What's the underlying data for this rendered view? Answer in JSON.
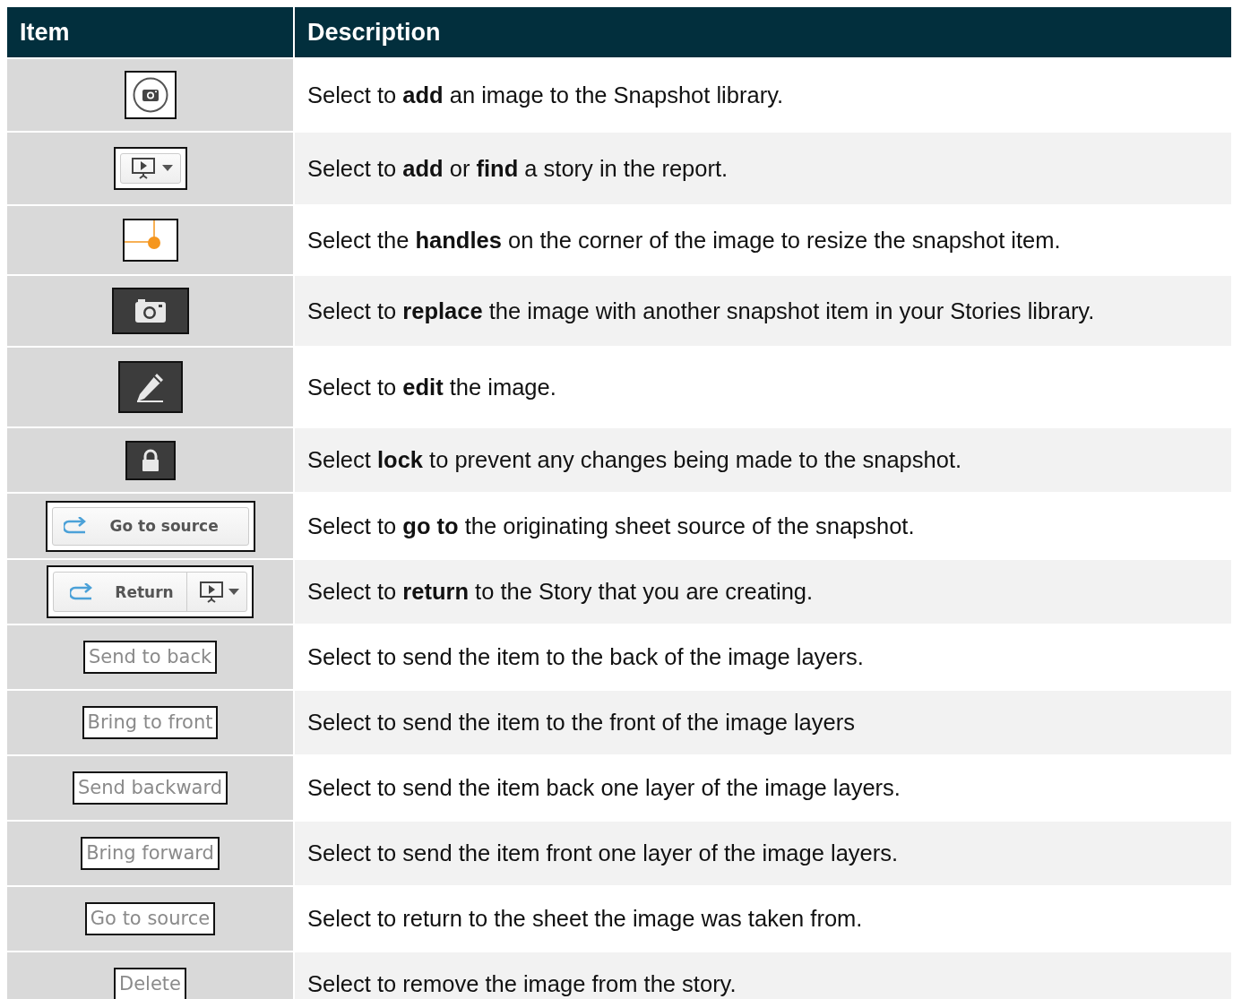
{
  "table": {
    "columns": [
      "Item",
      "Description"
    ],
    "rows": [
      {
        "item": {
          "kind": "camera-circle"
        },
        "description": "Select to **add** an image to the Snapshot library."
      },
      {
        "item": {
          "kind": "story-dropdown"
        },
        "description": "Select to **add** or **find** a story in the report."
      },
      {
        "item": {
          "kind": "handle"
        },
        "description": "Select the **handles** on the corner of the image to resize the snapshot item."
      },
      {
        "item": {
          "kind": "camera-dark"
        },
        "description": "Select to **replace** the image with another snapshot item in your Stories library."
      },
      {
        "item": {
          "kind": "pencil-dark"
        },
        "description": "Select to **edit** the image."
      },
      {
        "item": {
          "kind": "lock-dark"
        },
        "description": "Select **lock** to prevent any changes being made to the snapshot."
      },
      {
        "item": {
          "kind": "icon-button",
          "label": "Go to source"
        },
        "description": "Select to **go to** the originating sheet source of the snapshot."
      },
      {
        "item": {
          "kind": "split-button",
          "label": "Return"
        },
        "description": "Select to **return** to the Story that you are creating."
      },
      {
        "item": {
          "kind": "text-button",
          "label": "Send to back"
        },
        "description": "Select to send the item to the back of the image layers."
      },
      {
        "item": {
          "kind": "text-button",
          "label": "Bring to front"
        },
        "description": "Select to send the item to the front of the image layers"
      },
      {
        "item": {
          "kind": "text-button",
          "label": "Send backward"
        },
        "description": "Select to send the item back one layer of the image layers."
      },
      {
        "item": {
          "kind": "text-button",
          "label": "Bring forward"
        },
        "description": "Select to send the item front one layer of the image layers."
      },
      {
        "item": {
          "kind": "text-button",
          "label": "Go to source"
        },
        "description": "Select to return to the sheet the image was taken from."
      },
      {
        "item": {
          "kind": "text-button",
          "label": "Delete"
        },
        "description": "Select to remove the image from the story."
      }
    ]
  }
}
